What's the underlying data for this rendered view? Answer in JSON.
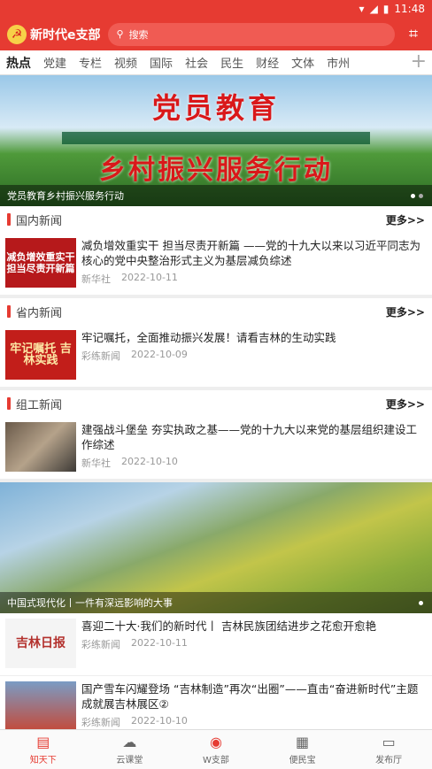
{
  "status": {
    "time": "11:48"
  },
  "header": {
    "logo": "新时代e支部",
    "search_placeholder": "搜索"
  },
  "tabs": [
    "热点",
    "党建",
    "专栏",
    "视频",
    "国际",
    "社会",
    "民生",
    "财经",
    "文体",
    "市州"
  ],
  "banner": {
    "line1": "党员教育",
    "line2": "乡村振兴服务行动",
    "caption": "党员教育乡村振兴服务行动"
  },
  "sections": [
    {
      "title": "国内新闻",
      "more": "更多>>",
      "item": {
        "thumb": "减负增效重实干 担当尽责开新篇",
        "title": "减负增效重实干 担当尽责开新篇 ——党的十九大以来以习近平同志为核心的党中央整治形式主义为基层减负综述",
        "source": "新华社",
        "date": "2022-10-11"
      }
    },
    {
      "title": "省内新闻",
      "more": "更多>>",
      "item": {
        "thumb": "牢记嘱托 吉林实践",
        "title": "牢记嘱托，全面推动振兴发展！请看吉林的生动实践",
        "source": "彩练新闻",
        "date": "2022-10-09"
      }
    },
    {
      "title": "组工新闻",
      "more": "更多>>",
      "item": {
        "thumb": "",
        "title": "建强战斗堡垒 夯实执政之基——党的十九大以来党的基层组织建设工作综述",
        "source": "新华社",
        "date": "2022-10-10"
      }
    }
  ],
  "feature": {
    "caption": "中国式现代化丨一件有深远影响的大事"
  },
  "list": [
    {
      "thumb": "吉林日报",
      "title": "喜迎二十大·我们的新时代丨 吉林民族团结进步之花愈开愈艳",
      "source": "彩练新闻",
      "date": "2022-10-11"
    },
    {
      "thumb": "",
      "title": "国产雪车闪耀登场 “吉林制造”再次“出圈”——直击“奋进新时代”主题成就展吉林展区②",
      "source": "彩练新闻",
      "date": "2022-10-10"
    }
  ],
  "nav": [
    {
      "label": "知天下",
      "icon": "document-icon"
    },
    {
      "label": "云课堂",
      "icon": "cloud-icon"
    },
    {
      "label": "W支部",
      "icon": "btx-icon"
    },
    {
      "label": "便民宝",
      "icon": "grid-icon"
    },
    {
      "label": "发布厅",
      "icon": "message-icon"
    }
  ],
  "colors": {
    "primary": "#e63b32"
  }
}
